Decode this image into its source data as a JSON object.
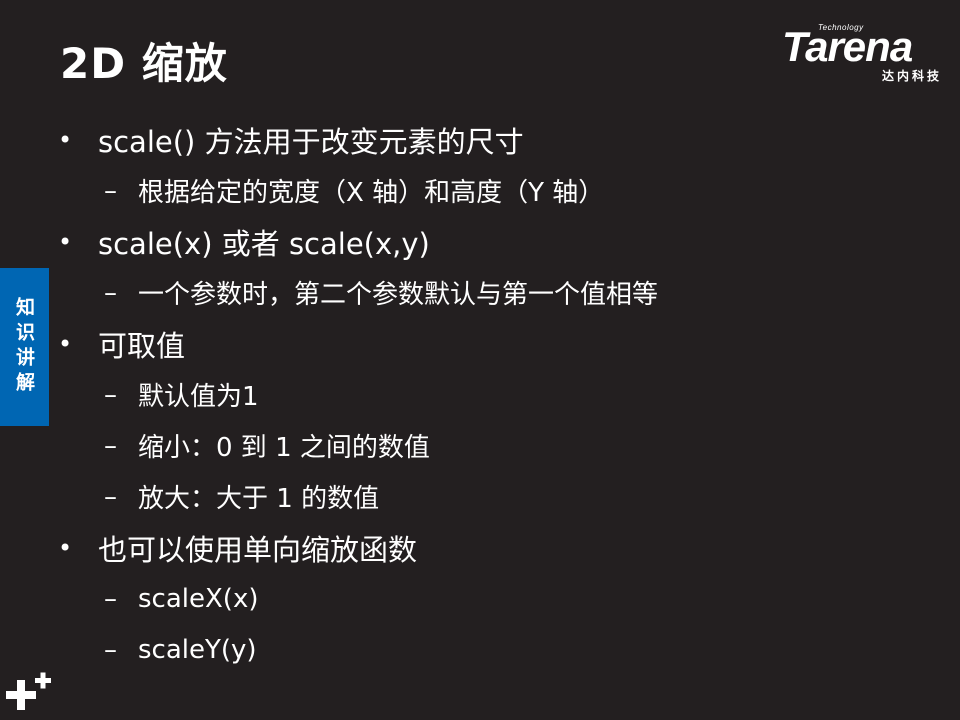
{
  "slide": {
    "title": "2D 缩放",
    "side_tab": "知识讲解"
  },
  "logo": {
    "small": "Technology",
    "word": "Tarena",
    "cn": "达内科技"
  },
  "bullets": [
    {
      "level": 1,
      "marker": "•",
      "text": "scale() 方法用于改变元素的尺寸"
    },
    {
      "level": 2,
      "marker": "–",
      "text": "根据给定的宽度（X 轴）和高度（Y 轴）"
    },
    {
      "level": 1,
      "marker": "•",
      "text": "scale(x) 或者 scale(x,y)"
    },
    {
      "level": 2,
      "marker": "–",
      "text": "一个参数时，第二个参数默认与第一个值相等"
    },
    {
      "level": 1,
      "marker": "•",
      "text": "可取值"
    },
    {
      "level": 2,
      "marker": "–",
      "text": "默认值为1"
    },
    {
      "level": 2,
      "marker": "–",
      "text": "缩小：0 到 1 之间的数值"
    },
    {
      "level": 2,
      "marker": "–",
      "text": "放大：大于 1 的数值"
    },
    {
      "level": 1,
      "marker": "•",
      "text": "也可以使用单向缩放函数"
    },
    {
      "level": 2,
      "marker": "–",
      "text": "scaleX(x)"
    },
    {
      "level": 2,
      "marker": "–",
      "text": "scaleY(y)"
    }
  ],
  "icons": {
    "corner": "plus-icon"
  }
}
